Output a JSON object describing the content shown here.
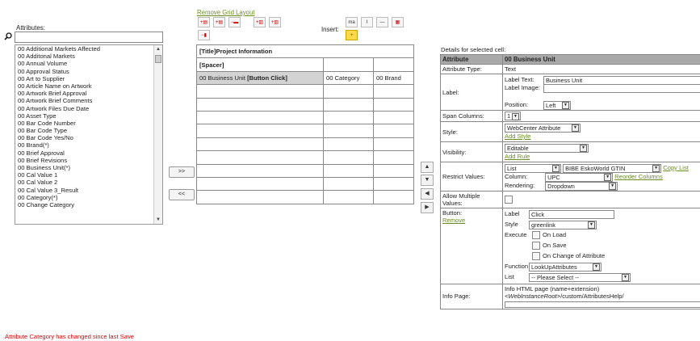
{
  "attributes": {
    "label": "Attributes:",
    "search_placeholder": "",
    "items": [
      "00 Additional Markets Affected",
      "00 Additonal Markets",
      "00 Annual Volume",
      "00 Approval Status",
      "00 Art to Supplier",
      "00 Article Name on Artwork",
      "00 Artwork Brief Approval",
      "00 Artwork Brief Comments",
      "00 Artwork Files Due Date",
      "00 Asset Type",
      "00 Bar Code Number",
      "00 Bar Code Type",
      "00 Bar Code Yes/No",
      "00 Brand(*)",
      "00 Brief Approval",
      "00 Brief Revisions",
      "00 Business Unit(*)",
      "00 Cal Value 1",
      "00 Cal Value 2",
      "00 Cal Value 3_Result",
      "00 Category(*)",
      "00 Change Category"
    ],
    "add_label": ">>",
    "remove_label": "<<"
  },
  "toolbar": {
    "remove_grid_layout": "Remove Grid Layout",
    "insert_label": "Insert:",
    "insert_icons": [
      "ma",
      "I",
      "—",
      "▦"
    ]
  },
  "grid": {
    "title_cell": "[Title]Project Information",
    "spacer_cell": "[Spacer]",
    "row3": {
      "c1_prefix": "00 Business Unit ",
      "c1_bold": "[Button Click]",
      "c2": "00 Category",
      "c3": "00 Brand"
    }
  },
  "details": {
    "title": "Details for selected cell:",
    "header_attribute": "Attribute",
    "header_value": "00 Business Unit",
    "attribute_type_label": "Attribute Type:",
    "attribute_type_value": "Text",
    "label_label": "Label:",
    "label_text_label": "Label Text:",
    "label_text_value": "Business Unit",
    "label_image_label": "Label Image:",
    "position_label": "Position:",
    "position_value": "Left",
    "span_label": "Span Columns:",
    "span_value": "1",
    "style_label": "Style:",
    "style_value": "WebCenter Attribute",
    "add_style": "Add Style",
    "visibility_label": "Visibility:",
    "visibility_value": "Editable",
    "add_rule": "Add Rule",
    "restrict_label": "Restrict Values:",
    "restrict_type": "List",
    "restrict_list": "BIBE EskoWorld GTIN",
    "copy_list": "Copy List",
    "column_label": "Column:",
    "column_value": "UPC",
    "reorder_columns": "Reorder Columns",
    "rendering_label": "Rendering:",
    "rendering_value": "Dropdown",
    "allow_multiple_label": "Allow Multiple Values:",
    "button_label": "Button:",
    "remove_link": "Remove",
    "btn_label_label": "Label",
    "btn_label_value": "Click",
    "btn_style_label": "Style",
    "btn_style_value": "greenlink",
    "execute_label": "Execute",
    "on_load": "On Load",
    "on_save": "On Save",
    "on_change": "On Change of Attribute",
    "function_label": "Function",
    "function_value": "LookUpAttributes",
    "list_label": "List",
    "list_value": "-- Please Select --",
    "info_page_label": "Info Page:",
    "info_line1": "Info HTML page (name+extension)",
    "info_line2_italic": "<WebInstanceRoot>",
    "info_line2_rest": "/custom/AttributesHelp/"
  },
  "status_message": "Attribute Category has changed since last Save",
  "colors": {
    "link": "#6b8e23",
    "status": "#e00000",
    "header_bg": "#a9a9a9",
    "selected_cell": "#d3d3d3"
  }
}
